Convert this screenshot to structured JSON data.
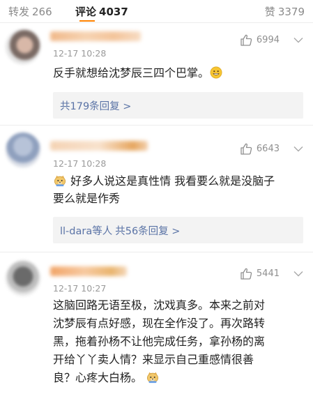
{
  "tabs": {
    "repost": {
      "label": "转发",
      "count": "266"
    },
    "comment": {
      "label": "评论",
      "count": "4037"
    },
    "like": {
      "label": "赞",
      "count": "3379"
    }
  },
  "comments": [
    {
      "time": "12-17 10:28",
      "likes": "6994",
      "text": "反手就想给沈梦辰三四个巴掌。",
      "emoji_after": "grin-emoji",
      "reply_prefix": "",
      "reply_label": "共179条回复 >"
    },
    {
      "time": "12-17 10:28",
      "likes": "6643",
      "emoji_before": "doge-emoji",
      "text_line1": "好多人说这是真性情 我看要么就是没脑子",
      "text_line2": "要么就是作秀",
      "reply_prefix": "ll-dara等人",
      "reply_label": "共56条回复 >"
    },
    {
      "time": "12-17 10:27",
      "likes": "5441",
      "lines": [
        "这脑回路无语至极，沈戏真多。本来之前对",
        "沈梦辰有点好感，现在全作没了。再次路转",
        "黑，拖着孙杨不让他完成任务，拿孙杨的离",
        "开给丫丫卖人情？来显示自己重感情很善",
        "良？心疼大白杨。"
      ],
      "emoji_after": "doge-emoji"
    }
  ],
  "colors": {
    "accent": "#ff8200",
    "link": "#5a73a6",
    "muted": "#9a9a9a",
    "replybg": "#f3f3f3"
  }
}
